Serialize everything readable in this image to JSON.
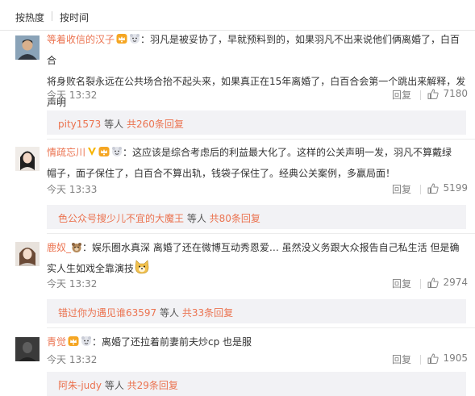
{
  "sort": {
    "hot": "按热度",
    "time": "按时间"
  },
  "comments": [
    {
      "user": "等着收信的汉子",
      "lines": [
        "：羽凡是被妥协了，早就预料到的，如果羽凡不出来说他们俩离婚了，白百合",
        "将身败名裂永远在公共场合抬不起头来，如果真正在15年离婚了，白百合会第一个跳出来解释，发",
        "声明"
      ],
      "time": "今天 13:32",
      "reply": "回复",
      "likes": "7180",
      "sub": {
        "user": "pity1573",
        "mid": " 等人 ",
        "count": "共260条回复"
      }
    },
    {
      "user": "情疏忘川",
      "lines": [
        "：这应该是综合考虑后的利益最大化了。这样的公关声明一发，羽凡不算戴绿",
        "帽子，面子保住了，白百合不算出轨，钱袋子保住了。经典公关案例，多赢局面！"
      ],
      "time": "今天 13:33",
      "reply": "回复",
      "likes": "5199",
      "sub": {
        "user": "色公众号搜少儿不宜的大魔王",
        "mid": " 等人 ",
        "count": "共80条回复"
      }
    },
    {
      "user": "鹿奴_",
      "lines": [
        "：娱乐圈水真深 离婚了还在微博互动秀恩爱… 虽然没义务跟大众报告自己私生活 但是确",
        "实人生如戏全靠演技"
      ],
      "time": "今天 13:32",
      "reply": "回复",
      "likes": "2974",
      "sub": {
        "user": "错过你为遇见谁63597",
        "mid": " 等人 ",
        "count": "共33条回复"
      }
    },
    {
      "user": "青觉",
      "lines": [
        "：离婚了还拉着前妻前夫炒cp 也是服"
      ],
      "time": "今天 13:32",
      "reply": "回复",
      "likes": "1905",
      "sub": {
        "user": "阿朱-judy",
        "mid": " 等人 ",
        "count": "共29条回复"
      }
    }
  ],
  "colors": {
    "link": "#eb7350",
    "meta": "#808080",
    "subbg": "#f2f2f5"
  },
  "icons": [
    "vip-crown-icon",
    "yellow-v-icon",
    "emoji-bear-icon",
    "emoji-dog-icon",
    "thumbs-up-icon"
  ]
}
